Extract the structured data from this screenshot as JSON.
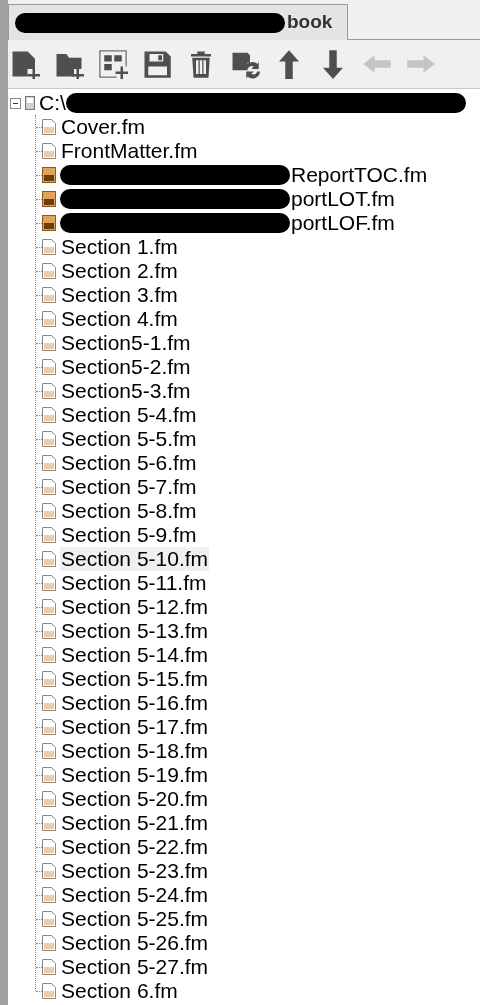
{
  "tab": {
    "title_visible_end": "book",
    "selected": true
  },
  "toolbar": [
    {
      "kind": "add-file",
      "disabled": false
    },
    {
      "kind": "add-folder",
      "disabled": false
    },
    {
      "kind": "add-group",
      "disabled": false
    },
    {
      "kind": "save",
      "disabled": false
    },
    {
      "kind": "delete",
      "disabled": false
    },
    {
      "kind": "update",
      "disabled": false
    },
    {
      "kind": "up",
      "disabled": false
    },
    {
      "kind": "down",
      "disabled": false
    },
    {
      "kind": "left",
      "disabled": true
    },
    {
      "kind": "right",
      "disabled": true
    }
  ],
  "tree": {
    "root": {
      "path_start": "C:\\",
      "expanded": true
    },
    "items": [
      {
        "kind": "doc",
        "label": "Cover.fm",
        "selected": false
      },
      {
        "kind": "doc",
        "label": "FrontMatter.fm",
        "selected": false
      },
      {
        "kind": "generated",
        "label": "ReportTOC.fm",
        "redacted": true,
        "selected": false
      },
      {
        "kind": "generated",
        "label": "portLOT.fm",
        "redacted": true,
        "selected": false
      },
      {
        "kind": "generated",
        "label": "portLOF.fm",
        "redacted": true,
        "selected": false
      },
      {
        "kind": "doc",
        "label": "Section 1.fm",
        "selected": false
      },
      {
        "kind": "doc",
        "label": "Section 2.fm",
        "selected": false
      },
      {
        "kind": "doc",
        "label": "Section 3.fm",
        "selected": false
      },
      {
        "kind": "doc",
        "label": "Section 4.fm",
        "selected": false
      },
      {
        "kind": "doc",
        "label": "Section5-1.fm",
        "selected": false
      },
      {
        "kind": "doc",
        "label": "Section5-2.fm",
        "selected": false
      },
      {
        "kind": "doc",
        "label": "Section5-3.fm",
        "selected": false
      },
      {
        "kind": "doc",
        "label": "Section 5-4.fm",
        "selected": false
      },
      {
        "kind": "doc",
        "label": "Section 5-5.fm",
        "selected": false
      },
      {
        "kind": "doc",
        "label": "Section 5-6.fm",
        "selected": false
      },
      {
        "kind": "doc",
        "label": "Section 5-7.fm",
        "selected": false
      },
      {
        "kind": "doc",
        "label": "Section 5-8.fm",
        "selected": false
      },
      {
        "kind": "doc",
        "label": "Section 5-9.fm",
        "selected": false
      },
      {
        "kind": "doc",
        "label": "Section 5-10.fm",
        "selected": true
      },
      {
        "kind": "doc",
        "label": "Section 5-11.fm",
        "selected": false
      },
      {
        "kind": "doc",
        "label": "Section 5-12.fm",
        "selected": false
      },
      {
        "kind": "doc",
        "label": "Section 5-13.fm",
        "selected": false
      },
      {
        "kind": "doc",
        "label": "Section 5-14.fm",
        "selected": false
      },
      {
        "kind": "doc",
        "label": "Section 5-15.fm",
        "selected": false
      },
      {
        "kind": "doc",
        "label": "Section 5-16.fm",
        "selected": false
      },
      {
        "kind": "doc",
        "label": "Section 5-17.fm",
        "selected": false
      },
      {
        "kind": "doc",
        "label": "Section 5-18.fm",
        "selected": false
      },
      {
        "kind": "doc",
        "label": "Section 5-19.fm",
        "selected": false
      },
      {
        "kind": "doc",
        "label": "Section 5-20.fm",
        "selected": false
      },
      {
        "kind": "doc",
        "label": "Section 5-21.fm",
        "selected": false
      },
      {
        "kind": "doc",
        "label": "Section 5-22.fm",
        "selected": false
      },
      {
        "kind": "doc",
        "label": "Section 5-23.fm",
        "selected": false
      },
      {
        "kind": "doc",
        "label": "Section 5-24.fm",
        "selected": false
      },
      {
        "kind": "doc",
        "label": "Section 5-25.fm",
        "selected": false
      },
      {
        "kind": "doc",
        "label": "Section 5-26.fm",
        "selected": false
      },
      {
        "kind": "doc",
        "label": "Section 5-27.fm",
        "selected": false
      },
      {
        "kind": "doc",
        "label": "Section 6.fm",
        "selected": false
      }
    ]
  }
}
